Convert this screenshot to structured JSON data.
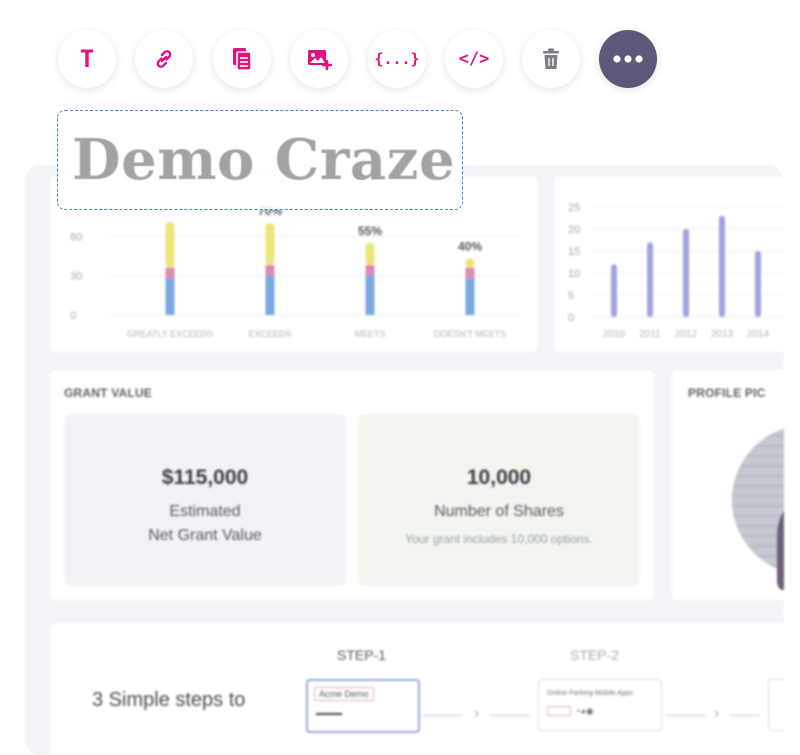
{
  "toolbar": {
    "buttons": [
      {
        "name": "text",
        "icon": "text-icon",
        "glyph": "T"
      },
      {
        "name": "link",
        "icon": "link-icon"
      },
      {
        "name": "copy",
        "icon": "copy-icon"
      },
      {
        "name": "add-image",
        "icon": "add-image-icon"
      },
      {
        "name": "variables",
        "icon": "variable-braces-icon",
        "glyph": "{...}"
      },
      {
        "name": "html-code",
        "icon": "code-icon",
        "glyph": "</>"
      },
      {
        "name": "delete",
        "icon": "trash-icon"
      },
      {
        "name": "more",
        "icon": "more-dots-icon"
      }
    ],
    "accent_color": "#e5127d",
    "more_bg": "#5d5878"
  },
  "selected_text": "Demo Craze",
  "grant_card": {
    "title": "GRANT VALUE",
    "estimated": {
      "value": "$115,000",
      "label_line1": "Estimated",
      "label_line2": "Net Grant Value"
    },
    "shares": {
      "value": "10,000",
      "label": "Number of Shares",
      "note": "Your grant includes 10,000 options."
    }
  },
  "profile_card": {
    "title": "PROFILE PIC"
  },
  "steps": {
    "intro": "3 Simple steps to",
    "step1": "STEP-1",
    "step2": "STEP-2",
    "thumb1_chip": "Acme Demo",
    "thumb2_title": "Online Parking Mobile Apps"
  },
  "chart_data": [
    {
      "type": "bar",
      "categories": [
        "GREATLY EXCEEDS",
        "EXCEEDS",
        "MEETS",
        "DOESN'T MEETS"
      ],
      "series": [
        {
          "values": [
            28,
            30,
            30,
            28
          ]
        },
        {
          "values": [
            8,
            8,
            8,
            8
          ]
        },
        {
          "values": [
            35,
            32,
            17,
            7
          ]
        }
      ],
      "data_labels": [
        "",
        "70%",
        "55%",
        "40%"
      ],
      "y_ticks": [
        "60",
        "30",
        "0"
      ],
      "ylim": [
        0,
        90
      ],
      "colors": [
        "#7aa7df",
        "#d98bb5",
        "#ece47a"
      ],
      "grid": true
    },
    {
      "type": "bar",
      "categories": [
        "2010",
        "2011",
        "2012",
        "2013",
        "2014"
      ],
      "values": [
        12,
        17,
        20,
        23,
        15
      ],
      "y_ticks": [
        "25",
        "20",
        "15",
        "10",
        "5",
        "0"
      ],
      "ylim": [
        0,
        25
      ],
      "colors": [
        "#9ea5e0"
      ],
      "grid": true
    }
  ]
}
